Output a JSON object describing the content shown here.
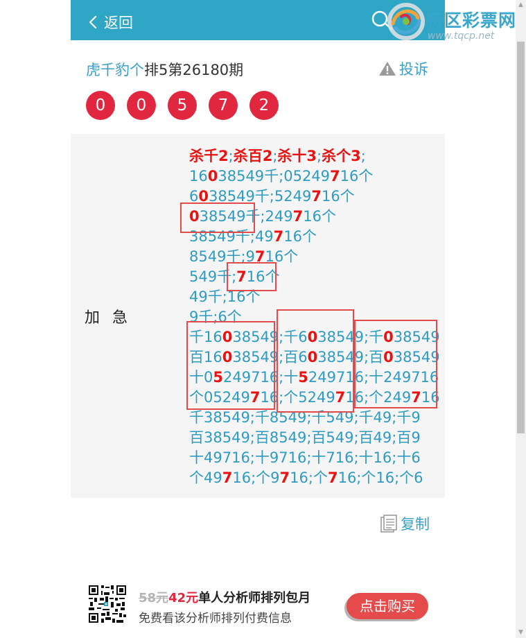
{
  "header": {
    "back_label": "返回",
    "brand_name": "特区彩票网",
    "brand_url": "www.tqcp.net"
  },
  "issue": {
    "author": "虎千豹个",
    "title": "排5第26180期",
    "complaint_label": "投诉"
  },
  "draw_numbers": [
    "0",
    "0",
    "5",
    "7",
    "2"
  ],
  "section_label": "加急",
  "kill_line": [
    "杀千2",
    "杀百2",
    "杀十3",
    "杀个3"
  ],
  "prediction_lines": [
    [
      {
        "t": "16"
      },
      {
        "t": "0",
        "h": true
      },
      {
        "t": "38549千;05249"
      },
      {
        "t": "7",
        "h": true
      },
      {
        "t": "16个"
      }
    ],
    [
      {
        "t": "6"
      },
      {
        "t": "0",
        "h": true
      },
      {
        "t": "38549千;5249"
      },
      {
        "t": "7",
        "h": true
      },
      {
        "t": "16个"
      }
    ],
    [
      {
        "t": "0",
        "h": true
      },
      {
        "t": "38549千;249"
      },
      {
        "t": "7",
        "h": true
      },
      {
        "t": "16个"
      }
    ],
    [
      {
        "t": "38549千;49"
      },
      {
        "t": "7",
        "h": true
      },
      {
        "t": "16个"
      }
    ],
    [
      {
        "t": "8549千;9"
      },
      {
        "t": "7",
        "h": true
      },
      {
        "t": "16个"
      }
    ],
    [
      {
        "t": "549千;"
      },
      {
        "t": "7",
        "h": true
      },
      {
        "t": "16个"
      }
    ],
    [
      {
        "t": "49千;16个"
      }
    ],
    [
      {
        "t": "9千;6个"
      }
    ],
    [
      {
        "t": "千16"
      },
      {
        "t": "0",
        "h": true
      },
      {
        "t": "38549;千6"
      },
      {
        "t": "0",
        "h": true
      },
      {
        "t": "38549;千"
      },
      {
        "t": "0",
        "h": true
      },
      {
        "t": "38549"
      }
    ],
    [
      {
        "t": "百16"
      },
      {
        "t": "0",
        "h": true
      },
      {
        "t": "38549;百6"
      },
      {
        "t": "0",
        "h": true
      },
      {
        "t": "38549;百"
      },
      {
        "t": "0",
        "h": true
      },
      {
        "t": "38549"
      }
    ],
    [
      {
        "t": "十0"
      },
      {
        "t": "5",
        "h": true
      },
      {
        "t": "249716;十"
      },
      {
        "t": "5",
        "h": true
      },
      {
        "t": "249716;十249716"
      }
    ],
    [
      {
        "t": "个05249"
      },
      {
        "t": "7",
        "h": true
      },
      {
        "t": "16;个5249"
      },
      {
        "t": "7",
        "h": true
      },
      {
        "t": "16;个249"
      },
      {
        "t": "7",
        "h": true
      },
      {
        "t": "16"
      }
    ],
    [
      {
        "t": "千38549;千8549;千549;千49;千9"
      }
    ],
    [
      {
        "t": "百38549;百8549;百549;百49;百9"
      }
    ],
    [
      {
        "t": "十49716;十9716;十716;十16;十6"
      }
    ],
    [
      {
        "t": "个49"
      },
      {
        "t": "7",
        "h": true
      },
      {
        "t": "16;个9"
      },
      {
        "t": "7",
        "h": true
      },
      {
        "t": "16;个"
      },
      {
        "t": "7",
        "h": true
      },
      {
        "t": "16;个16;个6"
      }
    ]
  ],
  "copy_label": "复制",
  "promo": {
    "old_price": "58元",
    "new_price": "42元",
    "title": "单人分析师排列包月",
    "subtitle": "免费看该分析师排列付费信息",
    "buy_label": "点击购买"
  },
  "colors": {
    "header_bg": "#2fa6c5",
    "ball_red": "#e0273f",
    "link_blue": "#3aa0c8",
    "highlight_red": "#e81212"
  }
}
